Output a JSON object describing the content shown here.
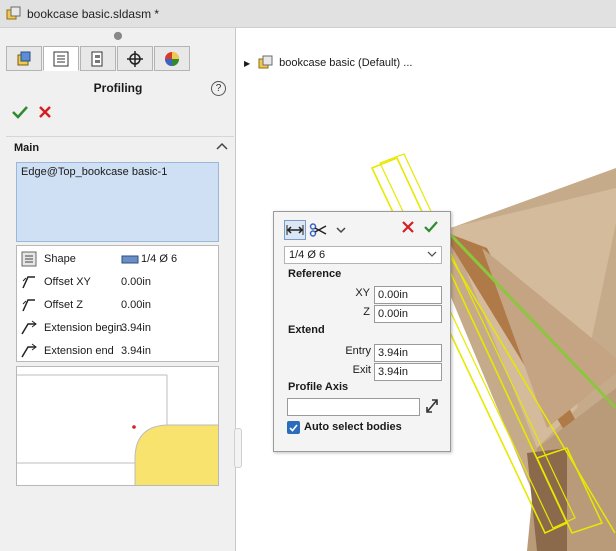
{
  "window": {
    "title": "bookcase basic.sldasm *"
  },
  "panel": {
    "title": "Profiling",
    "help_label": "?",
    "section": {
      "label": "Main"
    },
    "selection": {
      "value": "Edge@Top_bookcase basic-1"
    },
    "properties": [
      {
        "label": "Shape",
        "value": "1/4 Ø 6",
        "icon": "shape-list-icon"
      },
      {
        "label": "Offset XY",
        "value": "0.00in",
        "icon": "offset-icon"
      },
      {
        "label": "Offset Z",
        "value": "0.00in",
        "icon": "offset-icon"
      },
      {
        "label": "Extension begin",
        "value": "3.94in",
        "icon": "extension-icon"
      },
      {
        "label": "Extension end",
        "value": "3.94in",
        "icon": "extension-icon"
      }
    ],
    "tabs": [
      "feature-manager-icon",
      "property-manager-icon",
      "configuration-icon",
      "dimxpert-icon",
      "appearance-icon"
    ]
  },
  "tree": {
    "label": "bookcase basic (Default) ..."
  },
  "popup": {
    "shape_value": "1/4 Ø 6",
    "reference": {
      "label": "Reference",
      "xy_label": "XY",
      "xy_value": "0.00in",
      "z_label": "Z",
      "z_value": "0.00in"
    },
    "extend": {
      "label": "Extend",
      "entry_label": "Entry",
      "entry_value": "3.94in",
      "exit_label": "Exit",
      "exit_value": "3.94in"
    },
    "profile_axis": {
      "label": "Profile Axis",
      "value": ""
    },
    "auto_select": {
      "label": "Auto select bodies",
      "checked": true
    }
  },
  "colors": {
    "accent_ok": "#2e8b2e",
    "accent_cancel": "#d62020",
    "selection_bg": "#cfe0f4",
    "highlight": "#e8e800",
    "wood": "#c9ad8e"
  }
}
